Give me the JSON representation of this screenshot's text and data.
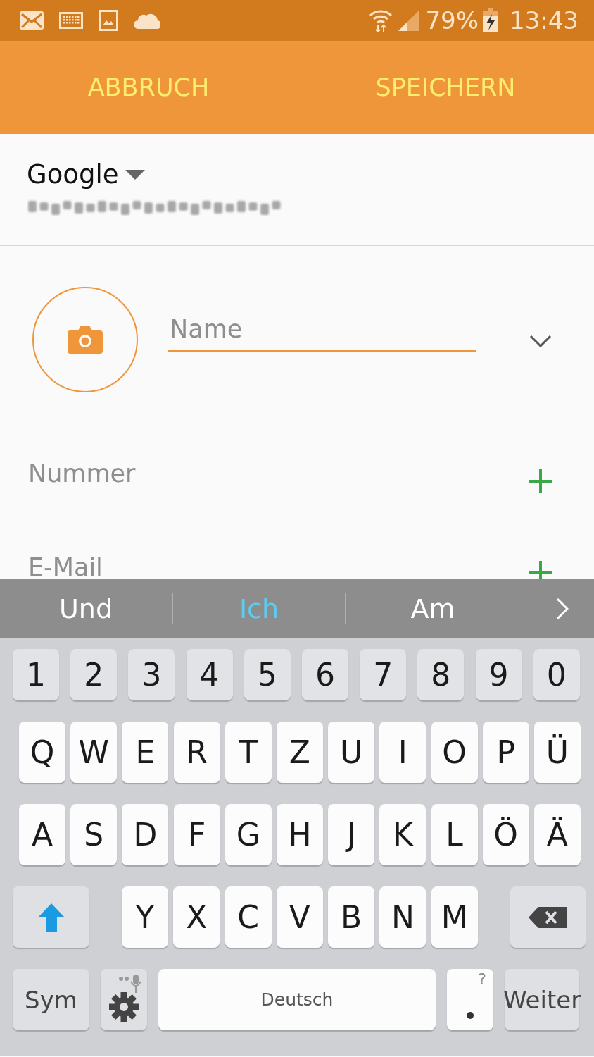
{
  "status_bar": {
    "battery": "79%",
    "time": "13:43"
  },
  "action_bar": {
    "buttons": [
      "ABBRUCH",
      "SPEICHERN"
    ]
  },
  "account": {
    "name": "Google"
  },
  "form": {
    "name_placeholder": "Name",
    "number_placeholder": "Nummer",
    "email_placeholder": "E-Mail"
  },
  "suggestions": [
    {
      "text": "Und",
      "selected": false
    },
    {
      "text": "Ich",
      "selected": true
    },
    {
      "text": "Am",
      "selected": false
    }
  ],
  "keyboard": {
    "rows": [
      {
        "kind": "number",
        "keys": [
          {
            "kind": "char",
            "label": "1"
          },
          {
            "kind": "char",
            "label": "2"
          },
          {
            "kind": "char",
            "label": "3"
          },
          {
            "kind": "char",
            "label": "4"
          },
          {
            "kind": "char",
            "label": "5"
          },
          {
            "kind": "char",
            "label": "6"
          },
          {
            "kind": "char",
            "label": "7"
          },
          {
            "kind": "char",
            "label": "8"
          },
          {
            "kind": "char",
            "label": "9"
          },
          {
            "kind": "char",
            "label": "0"
          }
        ]
      },
      {
        "kind": "letter",
        "keys": [
          {
            "kind": "char",
            "label": "Q"
          },
          {
            "kind": "char",
            "label": "W"
          },
          {
            "kind": "char",
            "label": "E"
          },
          {
            "kind": "char",
            "label": "R"
          },
          {
            "kind": "char",
            "label": "T"
          },
          {
            "kind": "char",
            "label": "Z"
          },
          {
            "kind": "char",
            "label": "U"
          },
          {
            "kind": "char",
            "label": "I"
          },
          {
            "kind": "char",
            "label": "O"
          },
          {
            "kind": "char",
            "label": "P"
          },
          {
            "kind": "char",
            "label": "Ü"
          }
        ]
      },
      {
        "kind": "letter",
        "keys": [
          {
            "kind": "char",
            "label": "A"
          },
          {
            "kind": "char",
            "label": "S"
          },
          {
            "kind": "char",
            "label": "D"
          },
          {
            "kind": "char",
            "label": "F"
          },
          {
            "kind": "char",
            "label": "G"
          },
          {
            "kind": "char",
            "label": "H"
          },
          {
            "kind": "char",
            "label": "J"
          },
          {
            "kind": "char",
            "label": "K"
          },
          {
            "kind": "char",
            "label": "L"
          },
          {
            "kind": "char",
            "label": "Ö"
          },
          {
            "kind": "char",
            "label": "Ä"
          }
        ]
      },
      {
        "kind": "shift",
        "keys": [
          {
            "kind": "shift"
          },
          {
            "kind": "char",
            "label": "Y"
          },
          {
            "kind": "char",
            "label": "X"
          },
          {
            "kind": "char",
            "label": "C"
          },
          {
            "kind": "char",
            "label": "V"
          },
          {
            "kind": "char",
            "label": "B"
          },
          {
            "kind": "char",
            "label": "N"
          },
          {
            "kind": "char",
            "label": "M"
          },
          {
            "kind": "backspace"
          }
        ]
      },
      {
        "kind": "bottom",
        "keys": [
          {
            "kind": "sym",
            "label": "Sym"
          },
          {
            "kind": "settings"
          },
          {
            "kind": "space",
            "label": "Deutsch"
          },
          {
            "kind": "period",
            "hint": "?"
          },
          {
            "kind": "enter",
            "label": "Weiter"
          }
        ]
      }
    ]
  }
}
